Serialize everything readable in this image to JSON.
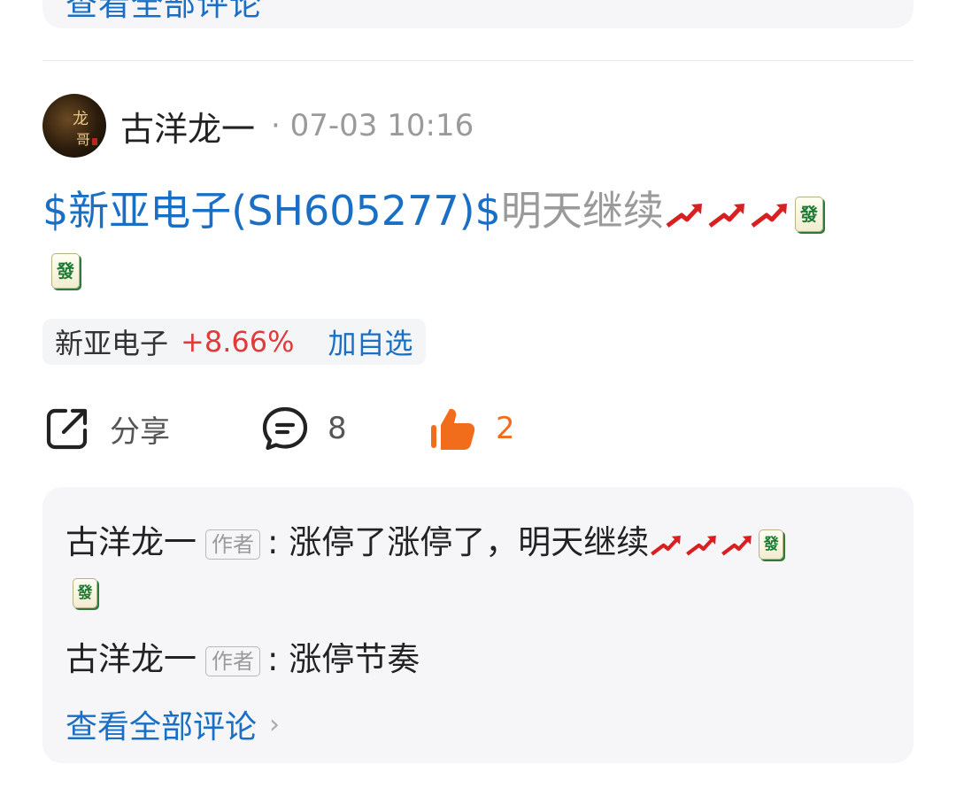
{
  "previous_card": {
    "view_all_label": "查看全部评论"
  },
  "post": {
    "author": "古洋龙一",
    "separator": "·",
    "timestamp": "07-03 10:16",
    "stock_tag": "$新亚电子(SH605277)$",
    "text": "明天继续",
    "emoji_fa_char": "發",
    "avatar_text": {
      "line1": "龙",
      "line2": "哥"
    }
  },
  "stock_chip": {
    "name": "新亚电子",
    "change": "+8.66%",
    "add_label": "加自选"
  },
  "actions": {
    "share_label": "分享",
    "comment_count": "8",
    "like_count": "2"
  },
  "comments": {
    "items": [
      {
        "author": "古洋龙一",
        "badge": "作者",
        "colon": ":",
        "text": "涨停了涨停了，明天继续"
      },
      {
        "author": "古洋龙一",
        "badge": "作者",
        "colon": ":",
        "text": "涨停节奏"
      }
    ],
    "view_all_label": "查看全部评论"
  },
  "colors": {
    "link_blue": "#1a6fc4",
    "up_red": "#e03a3a",
    "like_orange": "#f26d1b",
    "muted_gray": "#9a9a9a"
  },
  "icons": [
    "share-icon",
    "comment-icon",
    "thumbs-up-icon",
    "chart-increasing-emoji-icon",
    "mahjong-fa-emoji-icon",
    "chevron-right-icon"
  ]
}
